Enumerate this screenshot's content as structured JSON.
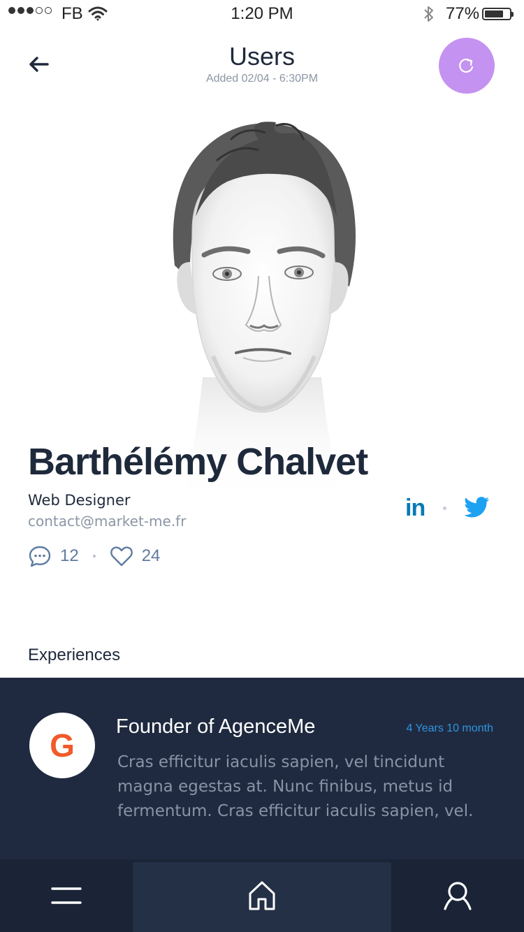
{
  "status_bar": {
    "carrier": "FB",
    "time": "1:20 PM",
    "battery_percent": "77%",
    "battery_level": 0.77,
    "signal_bars_filled": 3,
    "signal_bars_total": 5
  },
  "header": {
    "title": "Users",
    "subtitle": "Added 02/04 - 6:30PM",
    "back_icon": "arrow-left-icon",
    "refresh_icon": "refresh-icon",
    "accent_color": "#c492f1"
  },
  "profile": {
    "name": "Barthélémy Chalvet",
    "role": "Web Designer",
    "email": "contact@market-me.fr",
    "comments_count": "12",
    "likes_count": "24",
    "social": {
      "linkedin_label": "in",
      "linkedin_color": "#0b79b5",
      "twitter_color": "#1da1f2"
    }
  },
  "experiences": {
    "section_title": "Experiences",
    "items": [
      {
        "logo_letter": "G",
        "job_title": "Founder of AgenceMe",
        "duration": "4 Years 10 month",
        "description": "Cras efficitur iaculis sapien, vel tincidunt magna egestas at. Nunc finibus, metus id fermentum. Cras efficitur iaculis sapien, vel."
      }
    ]
  },
  "bottom_nav": {
    "items": [
      "menu-icon",
      "home-icon",
      "search-icon"
    ],
    "active": "home-icon"
  }
}
